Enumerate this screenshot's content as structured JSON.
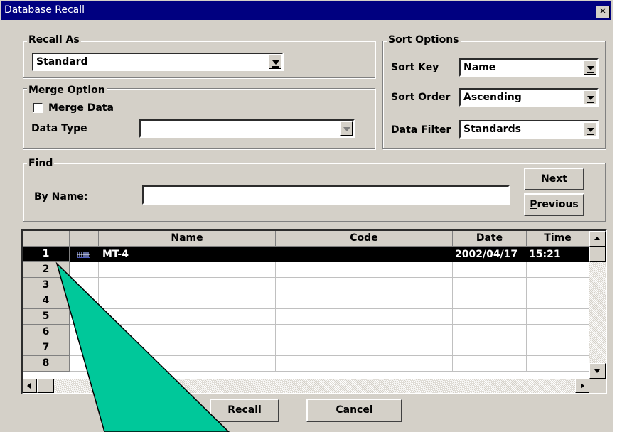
{
  "window": {
    "title": "Database Recall",
    "close_glyph": "✕"
  },
  "recall_as": {
    "legend": "Recall As",
    "value": "Standard"
  },
  "merge_option": {
    "legend": "Merge Option",
    "merge_data_label": "Merge Data",
    "merge_data_checked": false,
    "data_type_label": "Data Type",
    "data_type_value": ""
  },
  "sort_options": {
    "legend": "Sort Options",
    "sort_key_label": "Sort Key",
    "sort_key_value": "Name",
    "sort_order_label": "Sort Order",
    "sort_order_value": "Ascending",
    "data_filter_label": "Data Filter",
    "data_filter_value": "Standards"
  },
  "find": {
    "legend": "Find",
    "by_name_label": "By Name:",
    "by_name_value": "",
    "next_label": "Next",
    "next_mnemonic": "N",
    "next_rest": "ext",
    "previous_label": "Previous",
    "previous_mnemonic": "P",
    "previous_rest": "revious"
  },
  "grid": {
    "columns": [
      "",
      "",
      "Name",
      "Code",
      "Date",
      "Time"
    ],
    "rows": [
      {
        "num": "1",
        "icon": "standard-record-icon",
        "name": "MT-4",
        "code": "",
        "date": "2002/04/17",
        "time": "15:21",
        "selected": true
      },
      {
        "num": "2"
      },
      {
        "num": "3"
      },
      {
        "num": "4"
      },
      {
        "num": "5"
      },
      {
        "num": "6"
      },
      {
        "num": "7"
      },
      {
        "num": "8"
      }
    ]
  },
  "buttons": {
    "recall": "Recall",
    "cancel": "Cancel"
  },
  "colors": {
    "face": "#d4d0c8",
    "title_bar": "#000080",
    "callout": "#00c89a",
    "selection": "#000000"
  }
}
